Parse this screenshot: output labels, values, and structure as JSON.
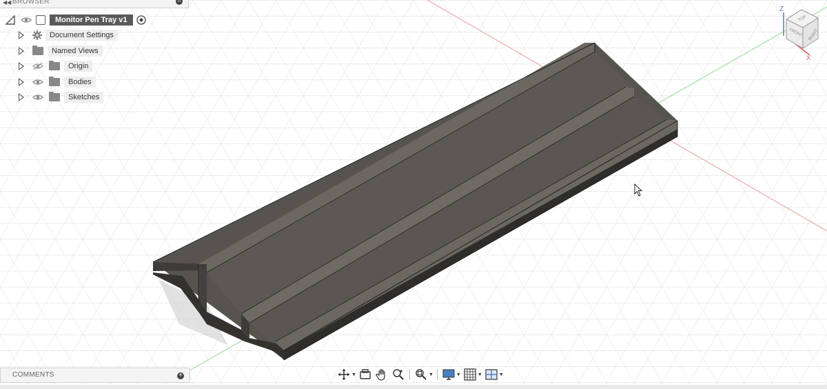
{
  "browser": {
    "title": "BROWSER",
    "root": {
      "label": "Monitor Pen Tray v1"
    },
    "items": [
      {
        "label": "Document Settings",
        "icon": "gear-icon"
      },
      {
        "label": "Named Views",
        "icon": "folder-icon"
      },
      {
        "label": "Origin",
        "icon": "folder-icon",
        "visibility": "hidden"
      },
      {
        "label": "Bodies",
        "icon": "folder-icon",
        "visibility": "visible"
      },
      {
        "label": "Sketches",
        "icon": "folder-icon",
        "visibility": "visible"
      }
    ]
  },
  "comments": {
    "title": "COMMENTS"
  },
  "viewcube": {
    "top": "TOP",
    "front": "FRONT",
    "right": "RIGHT",
    "z_axis": "Z",
    "x_axis": "X"
  },
  "toolbar": {
    "tools": [
      "orbit-icon",
      "look-at-icon",
      "pan-icon",
      "zoom-icon",
      "fit-icon",
      "display-settings-icon",
      "grid-icon",
      "viewports-icon"
    ]
  },
  "colors": {
    "body_top": "#5d5a55",
    "body_side": "#3f3d39",
    "grid": "#d8d8d8",
    "x_axis": "#e08a8a",
    "y_axis": "#7ccc7c",
    "root_chip": "#5a5a5a"
  }
}
